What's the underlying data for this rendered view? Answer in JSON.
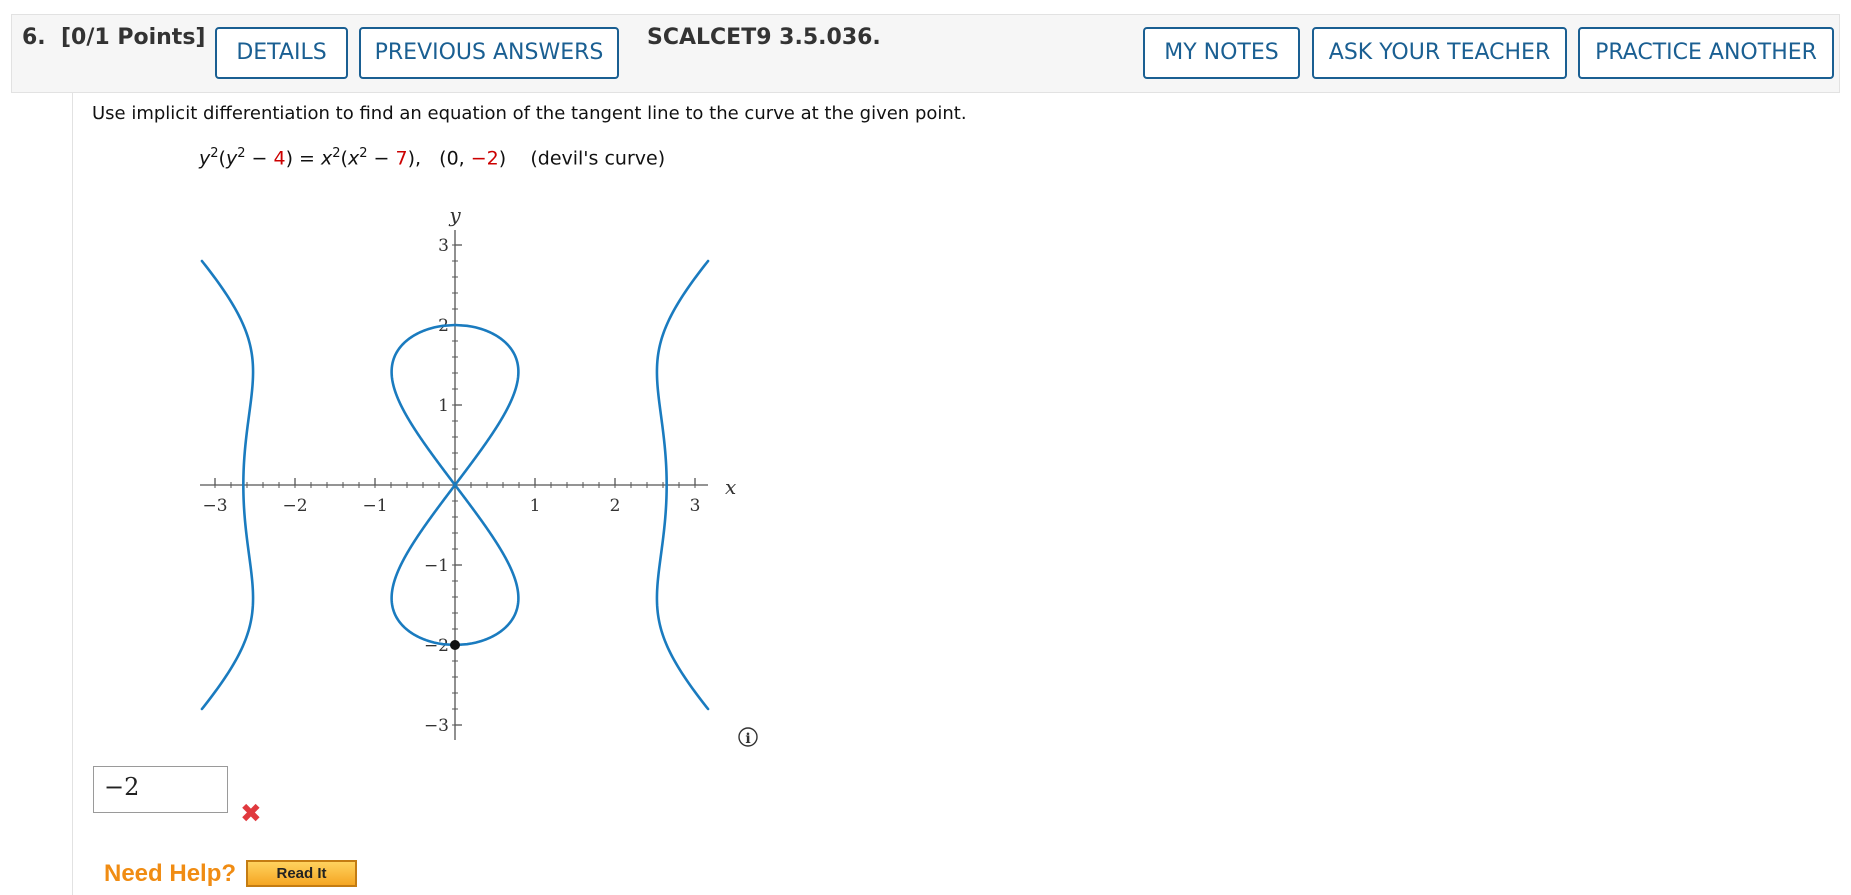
{
  "header": {
    "question_number": "6.",
    "points": "[0/1 Points]",
    "details_button": "DETAILS",
    "previous_answers_button": "PREVIOUS ANSWERS",
    "problem_code": "SCALCET9 3.5.036.",
    "my_notes_button": "MY NOTES",
    "ask_teacher_button": "ASK YOUR TEACHER",
    "practice_another_button": "PRACTICE ANOTHER"
  },
  "question": {
    "prompt": "Use implicit differentiation to find an equation of the tangent line to the curve at the given point.",
    "equation": {
      "lhs_var": "y",
      "lhs_exp": "2",
      "lhs_inner_var": "y",
      "lhs_inner_exp": "2",
      "lhs_const": "4",
      "rhs_var": "x",
      "rhs_exp": "2",
      "rhs_inner_var": "x",
      "rhs_inner_exp": "2",
      "rhs_const": "7",
      "point_x": "0",
      "point_y": "−2",
      "curve_name": "(devil's curve)"
    }
  },
  "graph": {
    "x_label": "x",
    "y_label": "y",
    "x_ticks": [
      "−3",
      "−2",
      "−1",
      "1",
      "2",
      "3"
    ],
    "y_ticks": [
      "3",
      "2",
      "1",
      "−1",
      "−2",
      "−3"
    ],
    "highlight_point": [
      0,
      -2
    ],
    "curve_color": "#1a7bbf",
    "info_icon": "info-icon"
  },
  "answer": {
    "value": "−2",
    "status": "incorrect",
    "status_icon": "x-mark-icon",
    "status_color": "#e0393e"
  },
  "help": {
    "need_help_label": "Need Help?",
    "read_it_button": "Read It"
  },
  "colors": {
    "button_border": "#1a5f92",
    "need_help": "#f08c13",
    "equation_constant": "#cc0000"
  }
}
